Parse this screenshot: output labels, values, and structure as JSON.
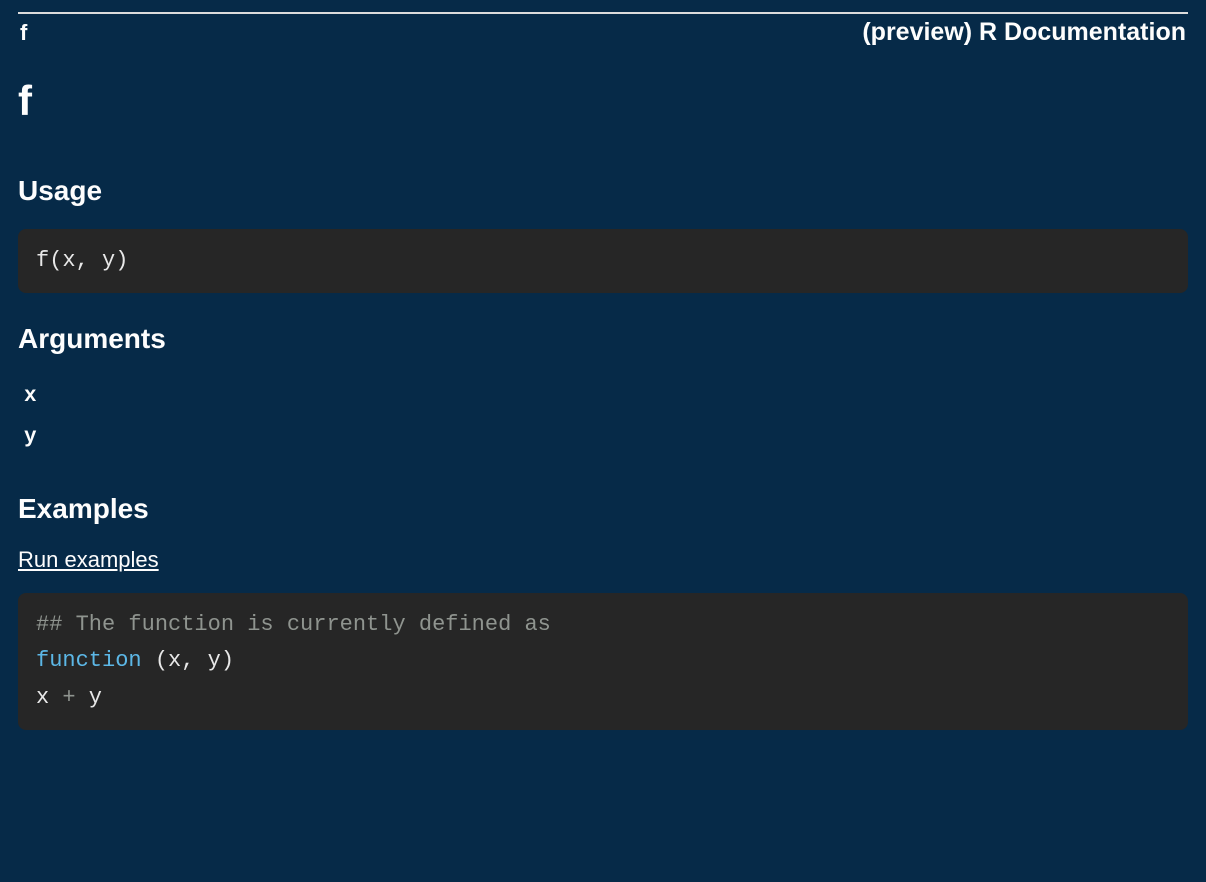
{
  "header": {
    "left": "f",
    "right": "(preview) R Documentation"
  },
  "title": "f",
  "sections": {
    "usage": "Usage",
    "arguments": "Arguments",
    "examples": "Examples"
  },
  "usage_code": "f(x, y)",
  "arguments_list": [
    "x",
    "y"
  ],
  "run_link": "Run examples",
  "example_code": {
    "comment": "## The function is currently defined as",
    "keyword": "function",
    "sig_rest": " (x, y)",
    "body_lhs": "x ",
    "body_op": "+",
    "body_rhs": " y"
  }
}
